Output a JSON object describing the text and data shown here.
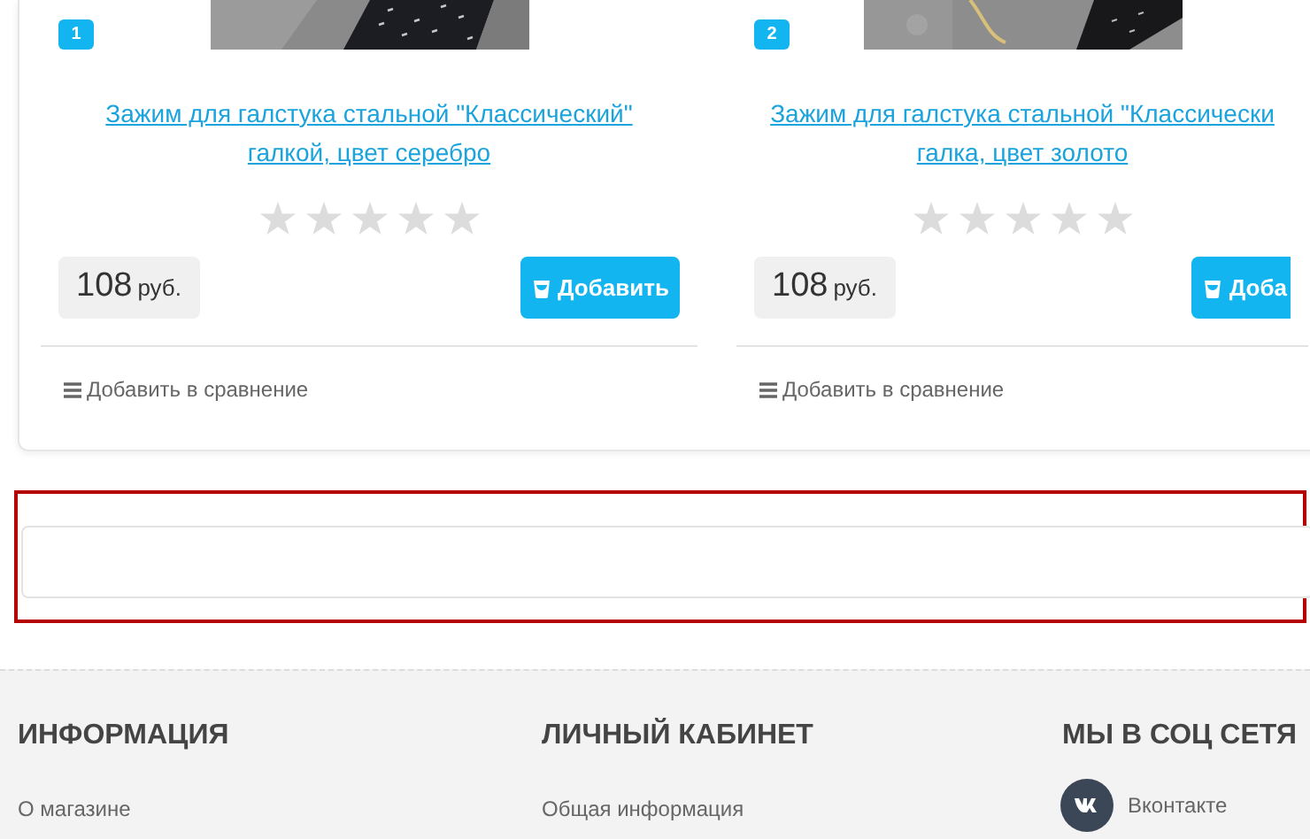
{
  "products": [
    {
      "badge": "1",
      "title_lines": [
        "Зажим для галстука стальной \"Классический\"",
        "галкой, цвет серебро"
      ],
      "stars": 0,
      "price": "108",
      "currency": "руб.",
      "button": "Добавить",
      "compare": "Добавить в сравнение"
    },
    {
      "badge": "2",
      "title_lines": [
        "Зажим для галстука стальной \"Классически",
        "галка, цвет золото"
      ],
      "stars": 0,
      "price": "108",
      "currency": "руб.",
      "button": "Доба",
      "compare": "Добавить в сравнение"
    }
  ],
  "footer": {
    "columns": [
      {
        "heading": "ИНФОРМАЦИЯ",
        "links": [
          {
            "label": "О магазине"
          }
        ]
      },
      {
        "heading": "ЛИЧНЫЙ КАБИНЕТ",
        "links": [
          {
            "label": "Общая информация"
          }
        ]
      },
      {
        "heading": "МЫ В СОЦ СЕТЯ",
        "links": [
          {
            "label": "Вконтакте",
            "kind": "vk"
          }
        ]
      }
    ]
  }
}
